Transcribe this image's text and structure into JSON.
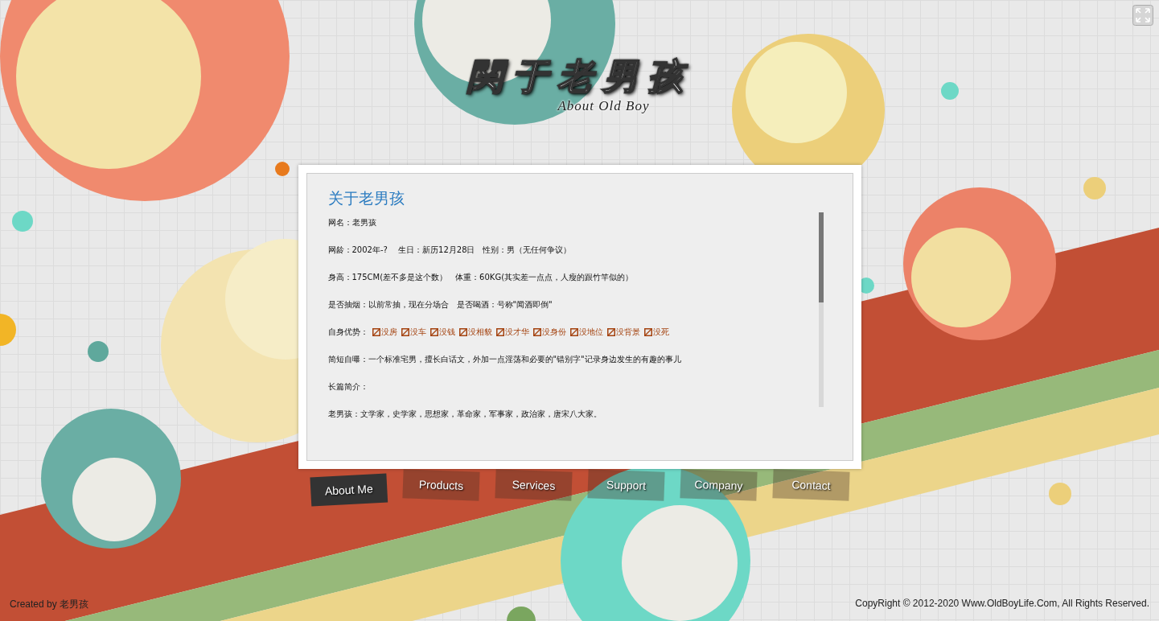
{
  "header": {
    "title": "関于老男孩",
    "subtitle": "About Old Boy"
  },
  "panel": {
    "heading": "关于老男孩",
    "lines": [
      {
        "kind": "text",
        "text": "网名：老男孩"
      },
      {
        "kind": "text",
        "text": "网龄：2002年-?　 生日：新历12月28日　性别：男（无任何争议）"
      },
      {
        "kind": "text",
        "text": "身高：175CM(差不多是这个数）　体重：60KG(其实差一点点，人瘦的跟竹竿似的）"
      },
      {
        "kind": "text",
        "text": "是否抽烟：以前常抽，现在分场合　是否喝酒：号称\"闻酒即倒\""
      },
      {
        "kind": "tags",
        "label": "自身优势：",
        "items": [
          "没房",
          "没车",
          "没钱",
          "没相貌",
          "没才华",
          "没身份",
          "没地位",
          "没背景",
          "没死"
        ]
      },
      {
        "kind": "text",
        "text": "简短自曝：一个标准宅男，擅长白话文，外加一点淫荡和必要的\"错别字\"记录身边发生的有趣的事儿"
      },
      {
        "kind": "text",
        "text": "长篇简介："
      },
      {
        "kind": "text",
        "text": "老男孩：文学家，史学家，思想家，革命家，军事家，政治家，唐宋八大家。"
      }
    ]
  },
  "nav": [
    {
      "label": "About Me",
      "selected": true
    },
    {
      "label": "Products",
      "selected": false
    },
    {
      "label": "Services",
      "selected": false
    },
    {
      "label": "Support",
      "selected": false
    },
    {
      "label": "Company",
      "selected": false
    },
    {
      "label": "Contact",
      "selected": false
    }
  ],
  "footer": {
    "credit": "Created by 老男孩",
    "copyright": "CopyRight © 2012-2020 Www.OldBoyLife.Com, All Rights Reserved."
  }
}
